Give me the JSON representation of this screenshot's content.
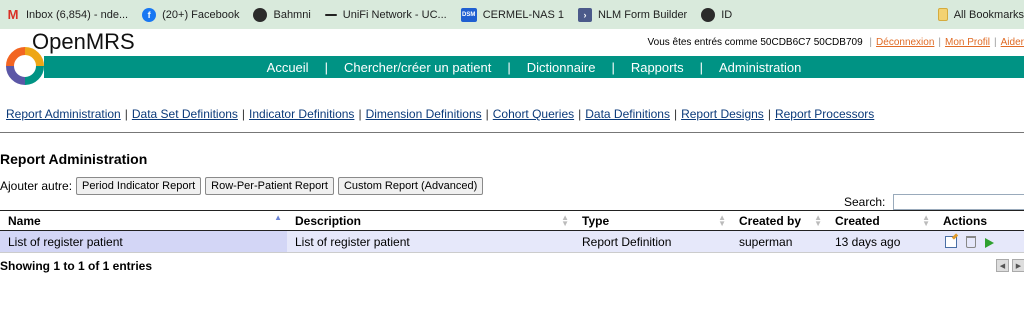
{
  "bookmarks": [
    {
      "icon": "gmail-icon",
      "label": "Inbox (6,854) - nde..."
    },
    {
      "icon": "facebook-icon",
      "label": "(20+) Facebook"
    },
    {
      "icon": "globe-icon",
      "label": "Bahmni"
    },
    {
      "icon": "dash-icon",
      "label": "UniFi Network - UC..."
    },
    {
      "icon": "dsm-icon",
      "label": "CERMEL-NAS 1"
    },
    {
      "icon": "nlm-icon",
      "label": "NLM Form Builder"
    },
    {
      "icon": "globe-icon",
      "label": "ID"
    }
  ],
  "bookmarks_right": {
    "icon": "folder-icon",
    "label": "All Bookmarks"
  },
  "header": {
    "logo_text": "OpenMRS",
    "user_prefix": "Vous êtes entrés comme 50CDB6C7 50CDB709",
    "logout": "Déconnexion",
    "profile": "Mon Profil",
    "help": "Aider",
    "sep": "|"
  },
  "nav": [
    "Accueil",
    "Chercher/créer un patient",
    "Dictionnaire",
    "Rapports",
    "Administration"
  ],
  "nav_sep": "|",
  "submenu": [
    "Report Administration",
    "Data Set Definitions",
    "Indicator Definitions",
    "Dimension Definitions",
    "Cohort Queries",
    "Data Definitions",
    "Report Designs",
    "Report Processors"
  ],
  "submenu_sep": "|",
  "page": {
    "title": "Report Administration",
    "add_label": "Ajouter autre:",
    "add_buttons": [
      "Period Indicator Report",
      "Row-Per-Patient Report",
      "Custom Report (Advanced)"
    ],
    "search_label": "Search:",
    "search_value": ""
  },
  "table": {
    "columns": [
      "Name",
      "Description",
      "Type",
      "Created by",
      "Created",
      "Actions"
    ],
    "rows": [
      {
        "name": "List of register patient",
        "description": "List of register patient",
        "type": "Report Definition",
        "created_by": "superman",
        "created": "13 days ago"
      }
    ],
    "info": "Showing 1 to 1 of 1 entries"
  },
  "colors": {
    "nav_bg": "#009384",
    "bookmarks_bg": "#d9eadc",
    "link": "#0b3a7a",
    "accent_link": "#e06b25",
    "row_bg": "#e6e8fa"
  }
}
